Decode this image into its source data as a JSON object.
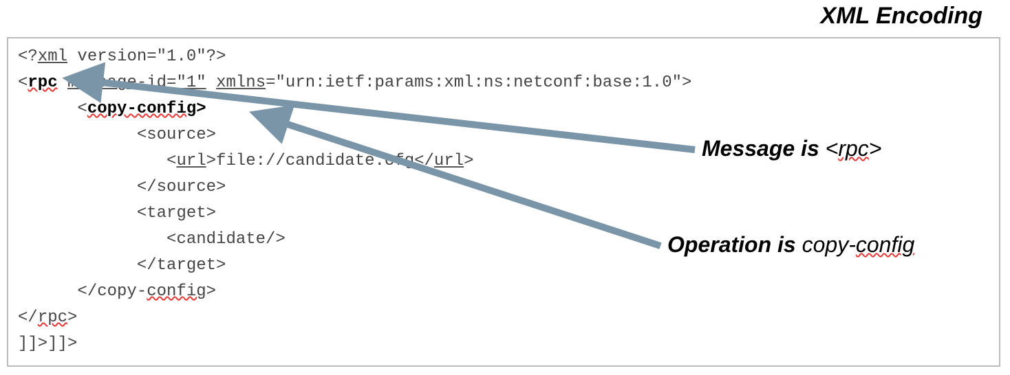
{
  "title": "XML Encoding",
  "code": {
    "l1_a": "<?",
    "l1_b": "xml",
    "l1_c": " version=\"1.0\"?>",
    "l2_a": "<",
    "l2_rpc": "rpc",
    "l2_b": " ",
    "l2_msgid": "message-id=\"1\"",
    "l2_c": " ",
    "l2_xmlns": "xmlns",
    "l2_d": "=\"urn:ietf:params:xml:ns:netconf:base:1.0\">",
    "l3_pad": "      <",
    "l3_copycfg": "copy-config",
    "l3_end": ">",
    "l4": "            <source>",
    "l5_a": "               <",
    "l5_url": "url",
    "l5_b": ">file://candidate.cfg</",
    "l5_url2": "url",
    "l5_c": ">",
    "l6": "            </source>",
    "l7": "            <target>",
    "l8": "               <candidate/>",
    "l9": "            </target>",
    "l10_a": "      </copy-",
    "l10_b": "config",
    "l10_c": ">",
    "l11_a": "</",
    "l11_b": "rpc",
    "l11_c": ">",
    "l12": "]]>]]>"
  },
  "annot1": {
    "prefix": "Message is ",
    "tag_open": "<",
    "tag_name": "rpc",
    "tag_close": ">"
  },
  "annot2": {
    "prefix": "Operation is ",
    "name_a": "copy-",
    "name_b": "config"
  },
  "colors": {
    "arrow": "#7b95a8"
  }
}
